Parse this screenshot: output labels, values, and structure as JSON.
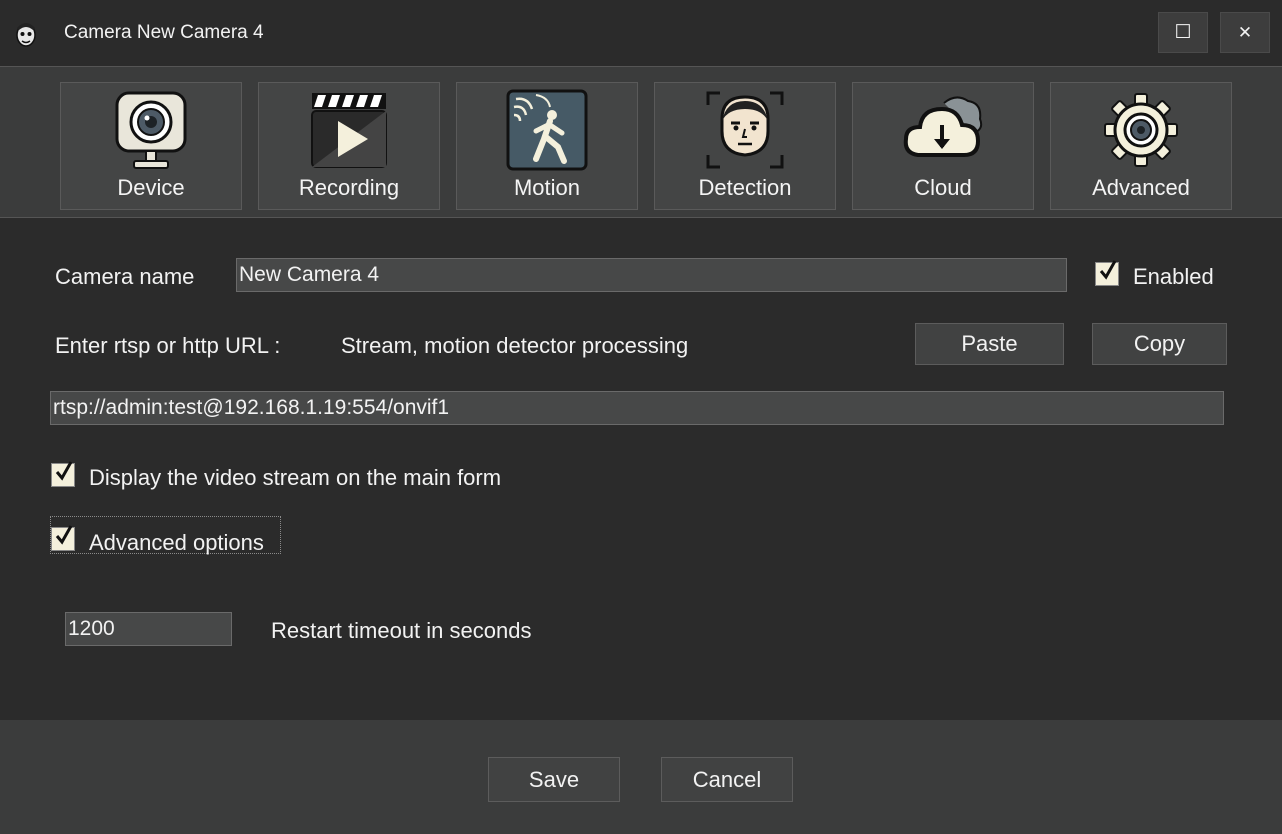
{
  "window": {
    "title": "Camera New Camera 4",
    "maximize_glyph": "☐",
    "close_glyph": "✕"
  },
  "tabs": [
    {
      "label": "Device",
      "icon": "webcam-icon"
    },
    {
      "label": "Recording",
      "icon": "clapperboard-icon"
    },
    {
      "label": "Motion",
      "icon": "motion-sensor-icon"
    },
    {
      "label": "Detection",
      "icon": "face-detection-icon"
    },
    {
      "label": "Cloud",
      "icon": "cloud-download-icon"
    },
    {
      "label": "Advanced",
      "icon": "gear-icon"
    }
  ],
  "form": {
    "camera_name_label": "Camera name",
    "camera_name_value": "New Camera 4",
    "enabled_label": "Enabled",
    "enabled_checked": true,
    "url_label": "Enter rtsp or http URL :",
    "url_hint": "Stream, motion detector processing",
    "paste_label": "Paste",
    "copy_label": "Copy",
    "url_value": "rtsp://admin:test@192.168.1.19:554/onvif1",
    "display_stream_label": "Display the video stream on the main form",
    "display_stream_checked": true,
    "advanced_options_label": "Advanced options",
    "advanced_options_checked": true,
    "restart_timeout_value": "1200",
    "restart_timeout_label": "Restart timeout in seconds"
  },
  "footer": {
    "save_label": "Save",
    "cancel_label": "Cancel"
  },
  "colors": {
    "background": "#2b2b2b",
    "panel": "#3b3c3c",
    "checkbox_fill": "#f4f0dc"
  }
}
